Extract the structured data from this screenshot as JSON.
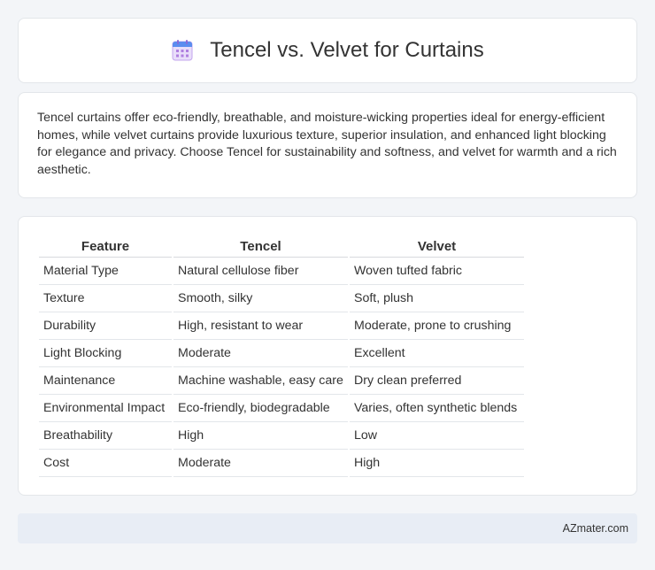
{
  "header": {
    "title": "Tencel vs. Velvet for Curtains",
    "icon": "calendar-icon"
  },
  "intro": {
    "text": "Tencel curtains offer eco-friendly, breathable, and moisture-wicking properties ideal for energy-efficient homes, while velvet curtains provide luxurious texture, superior insulation, and enhanced light blocking for elegance and privacy. Choose Tencel for sustainability and softness, and velvet for warmth and a rich aesthetic."
  },
  "table": {
    "headers": [
      "Feature",
      "Tencel",
      "Velvet"
    ],
    "rows": [
      [
        "Material Type",
        "Natural cellulose fiber",
        "Woven tufted fabric"
      ],
      [
        "Texture",
        "Smooth, silky",
        "Soft, plush"
      ],
      [
        "Durability",
        "High, resistant to wear",
        "Moderate, prone to crushing"
      ],
      [
        "Light Blocking",
        "Moderate",
        "Excellent"
      ],
      [
        "Maintenance",
        "Machine washable, easy care",
        "Dry clean preferred"
      ],
      [
        "Environmental Impact",
        "Eco-friendly, biodegradable",
        "Varies, often synthetic blends"
      ],
      [
        "Breathability",
        "High",
        "Low"
      ],
      [
        "Cost",
        "Moderate",
        "High"
      ]
    ]
  },
  "footer": {
    "text": "AZmater.com"
  },
  "colors": {
    "background": "#f3f5f8",
    "card": "#ffffff",
    "footer_bg": "#e8edf5",
    "icon_blue": "#5b8def",
    "icon_purple": "#b07fe0"
  }
}
